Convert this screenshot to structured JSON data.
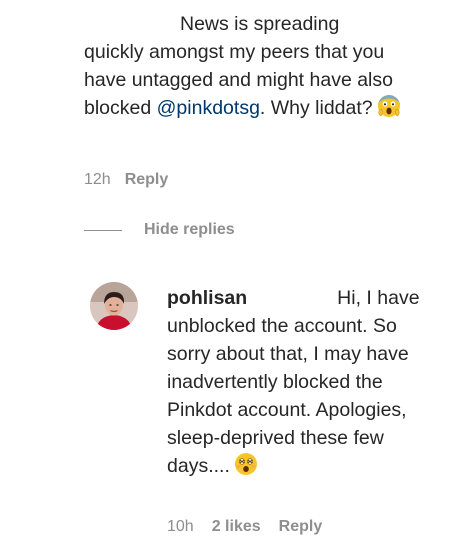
{
  "comment": {
    "text_line1": "News is spreading",
    "text_before_mention": "quickly amongst my peers that you have untagged and might have also blocked ",
    "mention": "@pinkdotsg",
    "text_after_mention": ". Why liddat?",
    "emoji_icon": "face-screaming-in-fear-icon",
    "time": "12h",
    "reply_label": "Reply"
  },
  "replies_toggle": {
    "label": "Hide replies"
  },
  "reply": {
    "avatar_icon": "user-avatar",
    "username": "pohlisan",
    "text_first": "Hi, I",
    "text_rest": "have unblocked the account. So sorry about that, I may have inadvertently blocked the Pinkdot account. Apologies, sleep-deprived these few days....",
    "emoji_icon": "astonished-face-icon",
    "time": "10h",
    "likes": "2 likes",
    "reply_label": "Reply"
  },
  "colors": {
    "text": "#262626",
    "secondary": "#8e8e8e",
    "mention": "#00376b"
  }
}
